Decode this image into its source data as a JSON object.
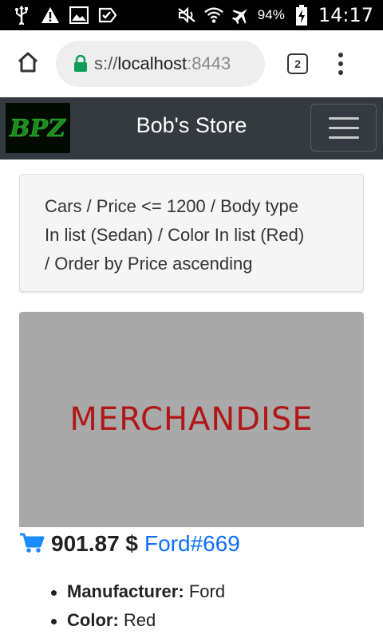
{
  "status_bar": {
    "battery_percent": "94%",
    "time": "14:17",
    "icons": [
      "usb-icon",
      "warning-icon",
      "image-icon",
      "clipboard-check-icon",
      "mute-icon",
      "wifi-icon",
      "airplane-icon",
      "battery-charging-icon"
    ]
  },
  "browser": {
    "url_prefix": "s://",
    "url_host": "localhost",
    "url_port": ":8443",
    "tab_count": "2"
  },
  "navbar": {
    "brand": "Bob's Store",
    "logo_text": "BPZ"
  },
  "breadcrumb": {
    "line1": "Cars / Price <= 1200 / Body type",
    "line2": "In list (Sedan) / Color In list (Red)",
    "line3": "/ Order by Price ascending"
  },
  "product": {
    "image_text": "MERCHANDISE",
    "price": "901.87 $",
    "link": "Ford#669",
    "details": [
      {
        "key": "Manufacturer:",
        "value": "Ford"
      },
      {
        "key": "Color:",
        "value": "Red"
      }
    ]
  },
  "colors": {
    "navbar_bg": "#343a40",
    "link": "#0d6efd",
    "cart": "#1a8cff",
    "merch_text": "#b01818",
    "lock": "#0f9d58"
  }
}
